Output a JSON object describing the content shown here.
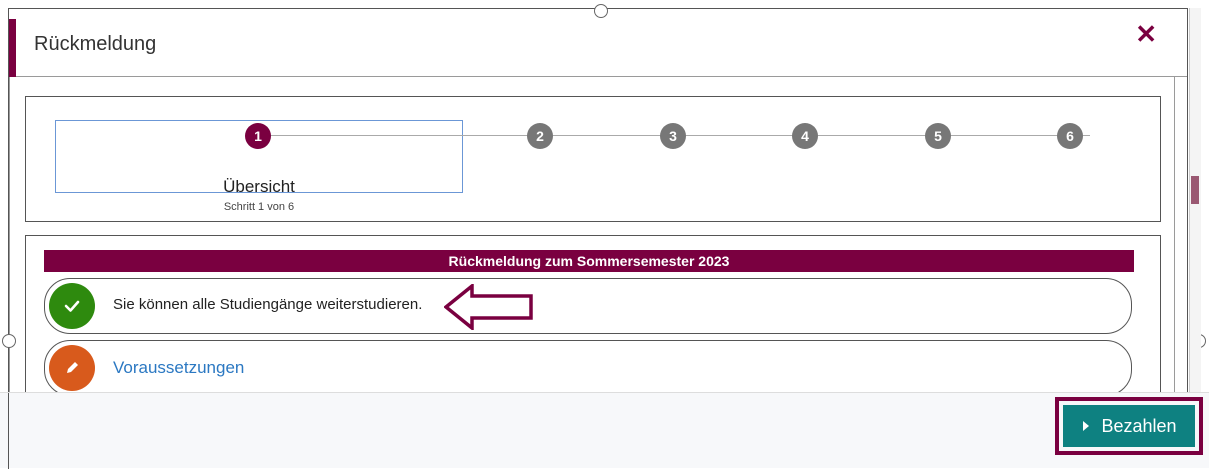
{
  "dialog": {
    "title": "Rückmeldung",
    "close_icon": "close-icon",
    "accent_color": "#7a0040"
  },
  "wizard": {
    "steps": [
      "1",
      "2",
      "3",
      "4",
      "5",
      "6"
    ],
    "active_step": 1,
    "active_title": "Übersicht",
    "active_subtitle": "Schritt 1 von 6"
  },
  "content": {
    "section_title": "Rückmeldung zum Sommersemester 2023",
    "items": [
      {
        "icon": "check-icon",
        "text": "Sie können alle Studiengänge weiterstudieren.",
        "color": "#2e8a0e"
      },
      {
        "icon": "pencil-icon",
        "text": "Voraussetzungen",
        "color": "#d85a1c"
      }
    ]
  },
  "footer": {
    "pay_label": "Bezahlen",
    "pay_color": "#0e8181"
  }
}
